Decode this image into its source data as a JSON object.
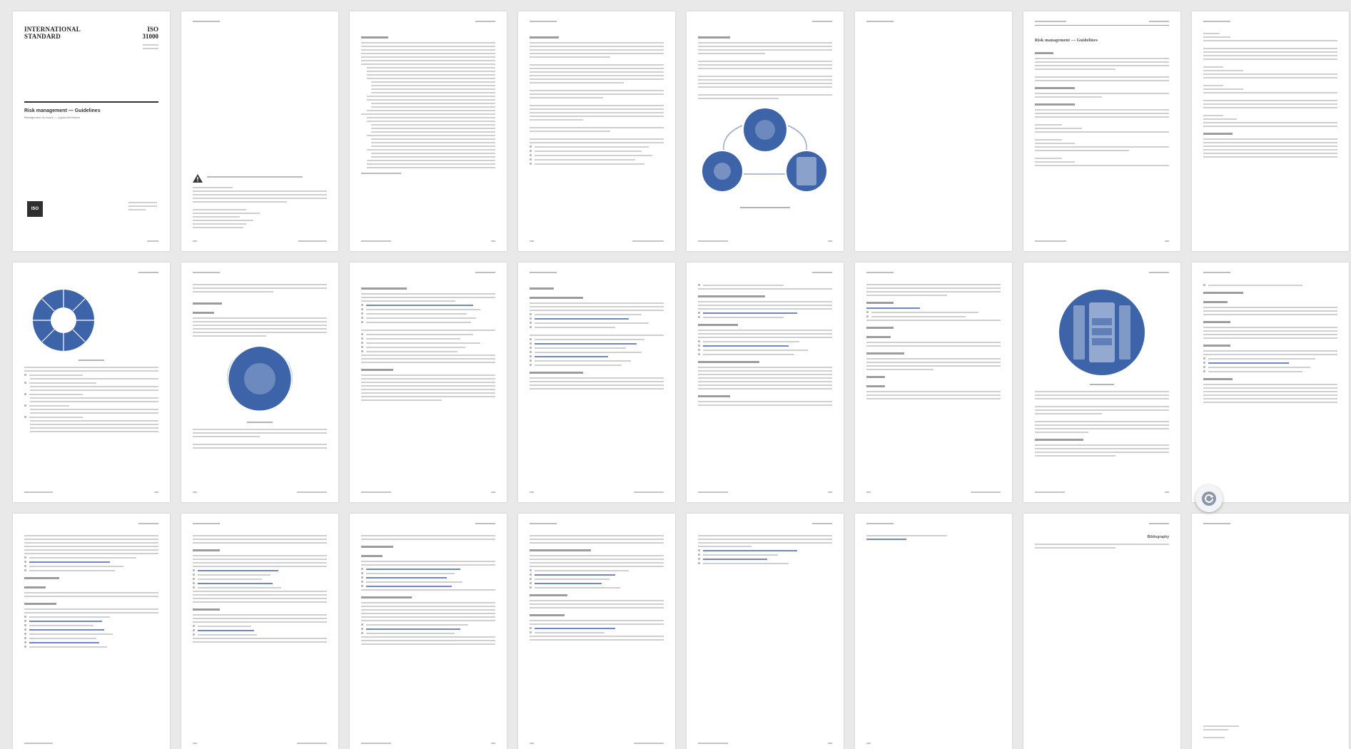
{
  "document": {
    "org_line_1": "INTERNATIONAL",
    "org_line_2": "STANDARD",
    "iso_label": "ISO",
    "iso_number": "31000",
    "cover_title": "Risk management — Guidelines",
    "cover_subtitle": "Management du risque — Lignes directrices",
    "logo_text": "ISO",
    "page9_title": "Risk management — Guidelines",
    "bibliography_heading": "Bibliography"
  },
  "icons": {
    "warning": "warning-triangle-icon",
    "refresh": "refresh-icon"
  },
  "colors": {
    "diagram_blue": "#3d63a8",
    "link_blue": "#6f86cf",
    "background": "#e9e9e9"
  }
}
